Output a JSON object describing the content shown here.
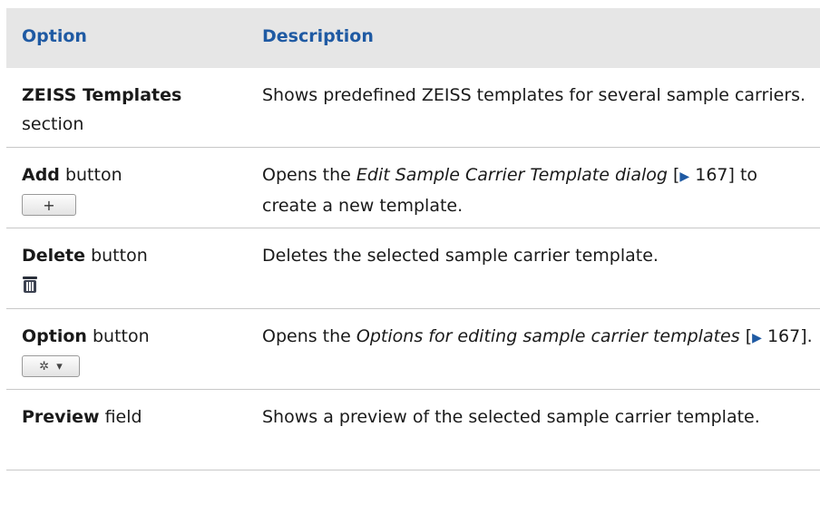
{
  "header": {
    "col1": "Option",
    "col2": "Description"
  },
  "rows": [
    {
      "name": "ZEISS Templates",
      "suffix": "section",
      "desc": "Shows predefined ZEISS templates for several sample carriers."
    },
    {
      "name": "Add",
      "suffix": "button",
      "icon": "plus-icon",
      "desc_pre": "Opens the ",
      "desc_link": "Edit Sample Carrier Template dialog",
      "desc_ref": "167",
      "desc_post": " to create a new template."
    },
    {
      "name": "Delete",
      "suffix": "button",
      "icon": "trash-icon",
      "desc": "Deletes the selected sample carrier template."
    },
    {
      "name": "Option",
      "suffix": "button",
      "icon": "gear-icon",
      "desc_pre": "Opens the ",
      "desc_link": "Options for editing sample carrier templates",
      "desc_ref": "167",
      "desc_post": "."
    },
    {
      "name": "Preview",
      "suffix": "field",
      "desc": "Shows a preview of the selected sample carrier template."
    }
  ]
}
